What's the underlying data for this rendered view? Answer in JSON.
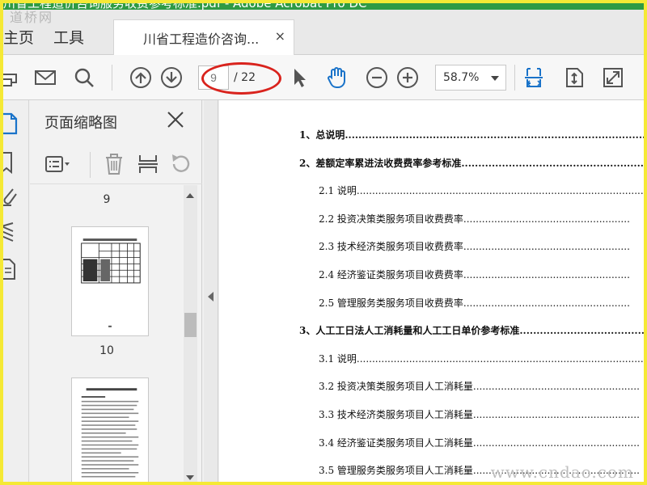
{
  "window": {
    "title": "川省工程造价咨询服务收费参考标准.pdf - Adobe Acrobat Pro DC",
    "watermark_top": "道桥网",
    "watermark_bottom": "www.cndao.com"
  },
  "nav": {
    "home": "主页",
    "tools": "工具"
  },
  "doc_tab": {
    "label": "川省工程造价咨询...",
    "close": "×"
  },
  "toolbar": {
    "page_current": "9",
    "page_total": "/ 22",
    "zoom": "58.7%"
  },
  "panel": {
    "title": "页面缩略图",
    "thumbnails": [
      {
        "page": "9"
      },
      {
        "page": "10"
      }
    ]
  },
  "toc": [
    {
      "level": 1,
      "text": "1、总说明..............................................................................................."
    },
    {
      "level": 1,
      "text": "2、差额定率累进法收费费率参考标准........................................................"
    },
    {
      "level": 2,
      "text": "2.1 说明...................................................................................................."
    },
    {
      "level": 2,
      "text": "2.2 投资决策类服务项目收费费率......................................................"
    },
    {
      "level": 2,
      "text": "2.3 技术经济类服务项目收费费率......................................................"
    },
    {
      "level": 2,
      "text": "2.4 经济鉴证类服务项目收费费率......................................................"
    },
    {
      "level": 2,
      "text": "2.5 管理服务类服务项目收费费率......................................................"
    },
    {
      "level": 1,
      "text": "3、人工工日法人工消耗量和人工工日单价参考标准........................................"
    },
    {
      "level": 2,
      "text": "3.1 说明...................................................................................................."
    },
    {
      "level": 2,
      "text": "3.2 投资决策类服务项目人工消耗量......................................................"
    },
    {
      "level": 2,
      "text": "3.3 技术经济类服务项目人工消耗量......................................................"
    },
    {
      "level": 2,
      "text": "3.4 经济鉴证类服务项目人工消耗量......................................................"
    },
    {
      "level": 2,
      "text": "3.5 管理服务类服务项目人工消耗量......................................................"
    }
  ],
  "colors": {
    "accent_blue": "#1a73c9",
    "title_green": "#2f9a45",
    "highlight_red": "#d9231d",
    "frame_yellow": "#f5e935"
  }
}
